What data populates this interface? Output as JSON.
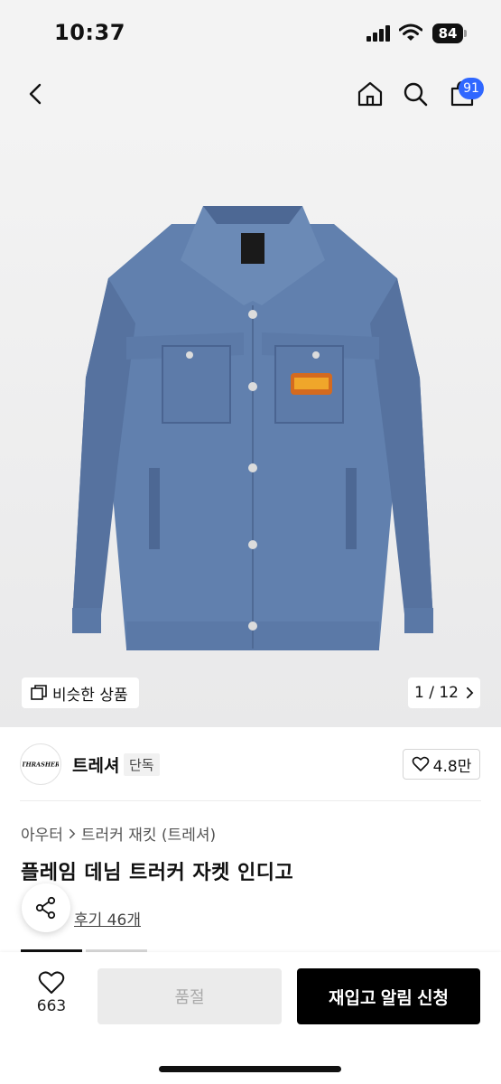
{
  "status_bar": {
    "time": "10:37",
    "battery": "84"
  },
  "nav": {
    "cart_count": "91"
  },
  "gallery": {
    "similar_label": "비슷한 상품",
    "page_indicator": "1 / 12"
  },
  "brand": {
    "name": "트레셔",
    "tag": "단독",
    "likes": "4.8만",
    "logo_text": "THRASHER"
  },
  "product": {
    "breadcrumb": [
      "아우터",
      "트러커 재킷 (트레셔)"
    ],
    "title": "플레임 데님 트러커 자켓 인디고",
    "review_link": "후기 46개"
  },
  "bottom_bar": {
    "wish_count": "663",
    "soldout_label": "품절",
    "notify_label": "재입고 알림 신청"
  },
  "colors": {
    "accent": "#2f67ff",
    "primary_button": "#000000",
    "denim": "#5f7fae"
  },
  "icons": [
    "chevron-left-icon",
    "home-icon",
    "search-icon",
    "cart-icon",
    "copy-icon",
    "chevron-right-icon",
    "heart-icon",
    "share-icon"
  ]
}
